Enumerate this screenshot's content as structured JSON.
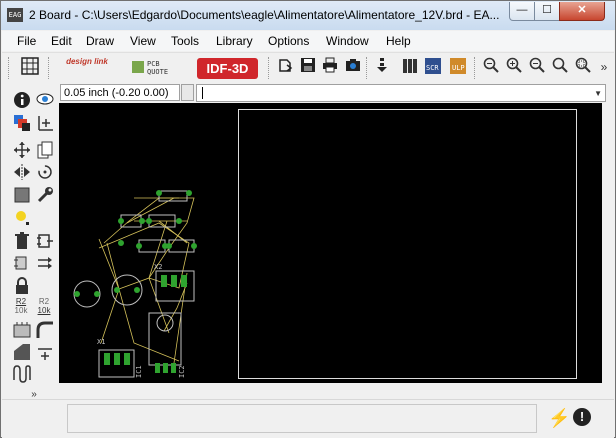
{
  "window": {
    "app_icon_text": "EAG",
    "title": "2 Board - C:\\Users\\Edgardo\\Documents\\eagle\\Alimentatore\\Alimentatore_12V.brd - EA...",
    "min_symbol": "—",
    "max_symbol": "☐",
    "close_symbol": "✕"
  },
  "menu": [
    "File",
    "Edit",
    "Draw",
    "View",
    "Tools",
    "Library",
    "Options",
    "Window",
    "Help"
  ],
  "toolbar": {
    "grid_icon": "grid-icon",
    "designlink_label": "design link",
    "pcbquote_label": "PCB QUOTE",
    "idf_label": "IDF-3D",
    "more_symbol": "»"
  },
  "command_row": {
    "coordinates": "0.05 inch (-0.20 0.00)",
    "command_value": ""
  },
  "left_tools": [
    "info-icon",
    "show-icon",
    "display-layers-icon",
    "mark-icon",
    "move-icon",
    "copy-icon",
    "mirror-icon",
    "rotate-icon",
    "group-icon",
    "change-icon",
    "smash-icon",
    "paste-icon",
    "delete-icon",
    "add-icon",
    "replace-icon",
    "name-icon",
    "lock-icon",
    "value-icon",
    "split-icon",
    "optimize-icon",
    "miter-icon",
    "route-icon",
    "more-icon",
    "meander-icon"
  ],
  "left_tool_labels": {
    "name_label": "R2",
    "value_label": "10k",
    "value_label2": "R2",
    "value_label3": "10k"
  },
  "board": {
    "parts": [
      "X1",
      "X2",
      "C1",
      "C2",
      "IC1",
      "IC2"
    ]
  },
  "colors": {
    "canvas_bg": "#000000",
    "board_outline": "#dddddd",
    "pad": "#2fa32f",
    "wire": "#d4c15a",
    "silkscreen": "#bfbfbf",
    "idf_button": "#d0262b"
  },
  "status": {
    "message": "",
    "bolt_icon": "lightning-icon",
    "info_symbol": "!"
  }
}
